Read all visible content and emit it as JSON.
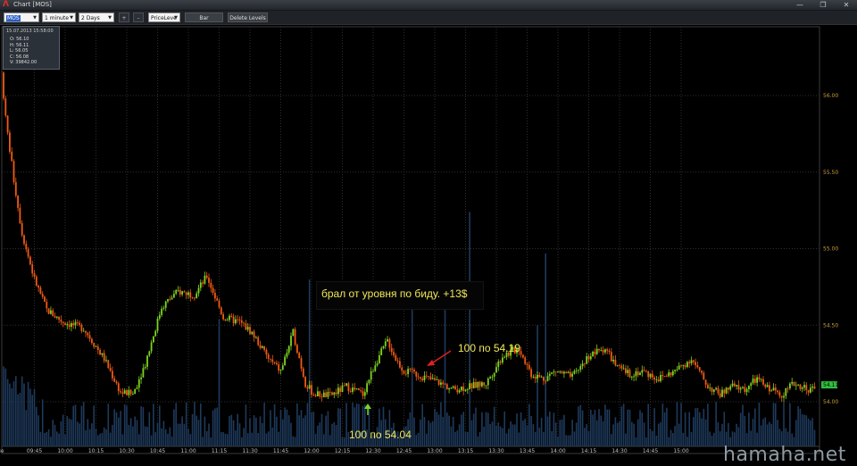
{
  "window": {
    "title": "Chart [MOS]",
    "controls": [
      "minimize-icon",
      "restore-icon",
      "close-icon"
    ]
  },
  "toolbar": {
    "symbol": "MOS",
    "interval": "1 minute",
    "range": "2 Days",
    "plus": "+",
    "minus": "–",
    "indicator": "PriceLeve",
    "style_btn": "Bar",
    "delete_levels": "Delete Levels"
  },
  "ohlc_panel": {
    "datetime": "15.07.2013 15:58:00",
    "open": "O: 56.10",
    "high": "H: 56.11",
    "low": "L: 56.05",
    "close": "C: 56.08",
    "volume": "V: 39842.00"
  },
  "annotations": {
    "comment": "брал от уровня по биду. +13$",
    "buy_label": "100 по 54.04",
    "sell_label": "100 по 54.19"
  },
  "watermark": "hamaha.net",
  "colors": {
    "up": "#7ed321",
    "down": "#f05a14",
    "grid": "#2e2e2e",
    "axis": "#c8a03c",
    "volume": "#1e3a5c",
    "last_price_bg": "#2fbf3f",
    "arrow_buy": "#7ed321",
    "arrow_sell": "#e02020"
  },
  "chart_data": {
    "type": "candlestick",
    "y_ticks": [
      "56.00",
      "55.50",
      "55.00",
      "54.50",
      "54.00"
    ],
    "y_tick_values": [
      56.0,
      55.5,
      55.0,
      54.5,
      54.0
    ],
    "ylim": [
      53.88,
      56.3
    ],
    "last_price": "54.11",
    "last_price_value": 54.11,
    "x_ticks": [
      "Tue",
      "09:45",
      "10:00",
      "10:15",
      "10:30",
      "10:45",
      "11:00",
      "11:15",
      "11:30",
      "11:45",
      "12:00",
      "12:15",
      "12:30",
      "12:45",
      "13:00",
      "13:15",
      "13:30",
      "13:45",
      "14:00",
      "14:15",
      "14:30",
      "14:45",
      "15:00"
    ],
    "x_minutes": [
      -2,
      15,
      30,
      45,
      60,
      75,
      90,
      105,
      120,
      135,
      150,
      165,
      180,
      195,
      210,
      225,
      240,
      255,
      270,
      285,
      300,
      315,
      330
    ],
    "price_path_minutes": [
      0,
      2,
      6,
      10,
      16,
      22,
      30,
      40,
      50,
      58,
      64,
      70,
      78,
      86,
      94,
      100,
      108,
      116,
      122,
      130,
      136,
      142,
      148,
      152,
      160,
      168,
      176,
      182,
      188,
      192,
      196,
      202,
      208,
      214,
      220,
      228,
      236,
      244,
      252,
      258,
      264,
      270,
      278,
      286,
      294,
      300,
      306,
      312,
      320,
      328,
      336,
      344,
      350,
      356,
      362,
      368,
      372,
      380,
      386,
      394,
      400
    ],
    "price_path_values": [
      56.15,
      55.85,
      55.45,
      55.1,
      54.8,
      54.6,
      54.52,
      54.48,
      54.28,
      54.06,
      54.05,
      54.25,
      54.62,
      54.72,
      54.7,
      54.82,
      54.55,
      54.52,
      54.45,
      54.28,
      54.2,
      54.45,
      54.12,
      54.05,
      54.04,
      54.1,
      54.05,
      54.25,
      54.4,
      54.28,
      54.2,
      54.18,
      54.15,
      54.12,
      54.08,
      54.1,
      54.12,
      54.3,
      54.35,
      54.18,
      54.15,
      54.2,
      54.16,
      54.3,
      54.35,
      54.22,
      54.18,
      54.2,
      54.15,
      54.2,
      54.28,
      54.1,
      54.05,
      54.1,
      54.08,
      54.15,
      54.1,
      54.05,
      54.12,
      54.08,
      54.11
    ]
  }
}
